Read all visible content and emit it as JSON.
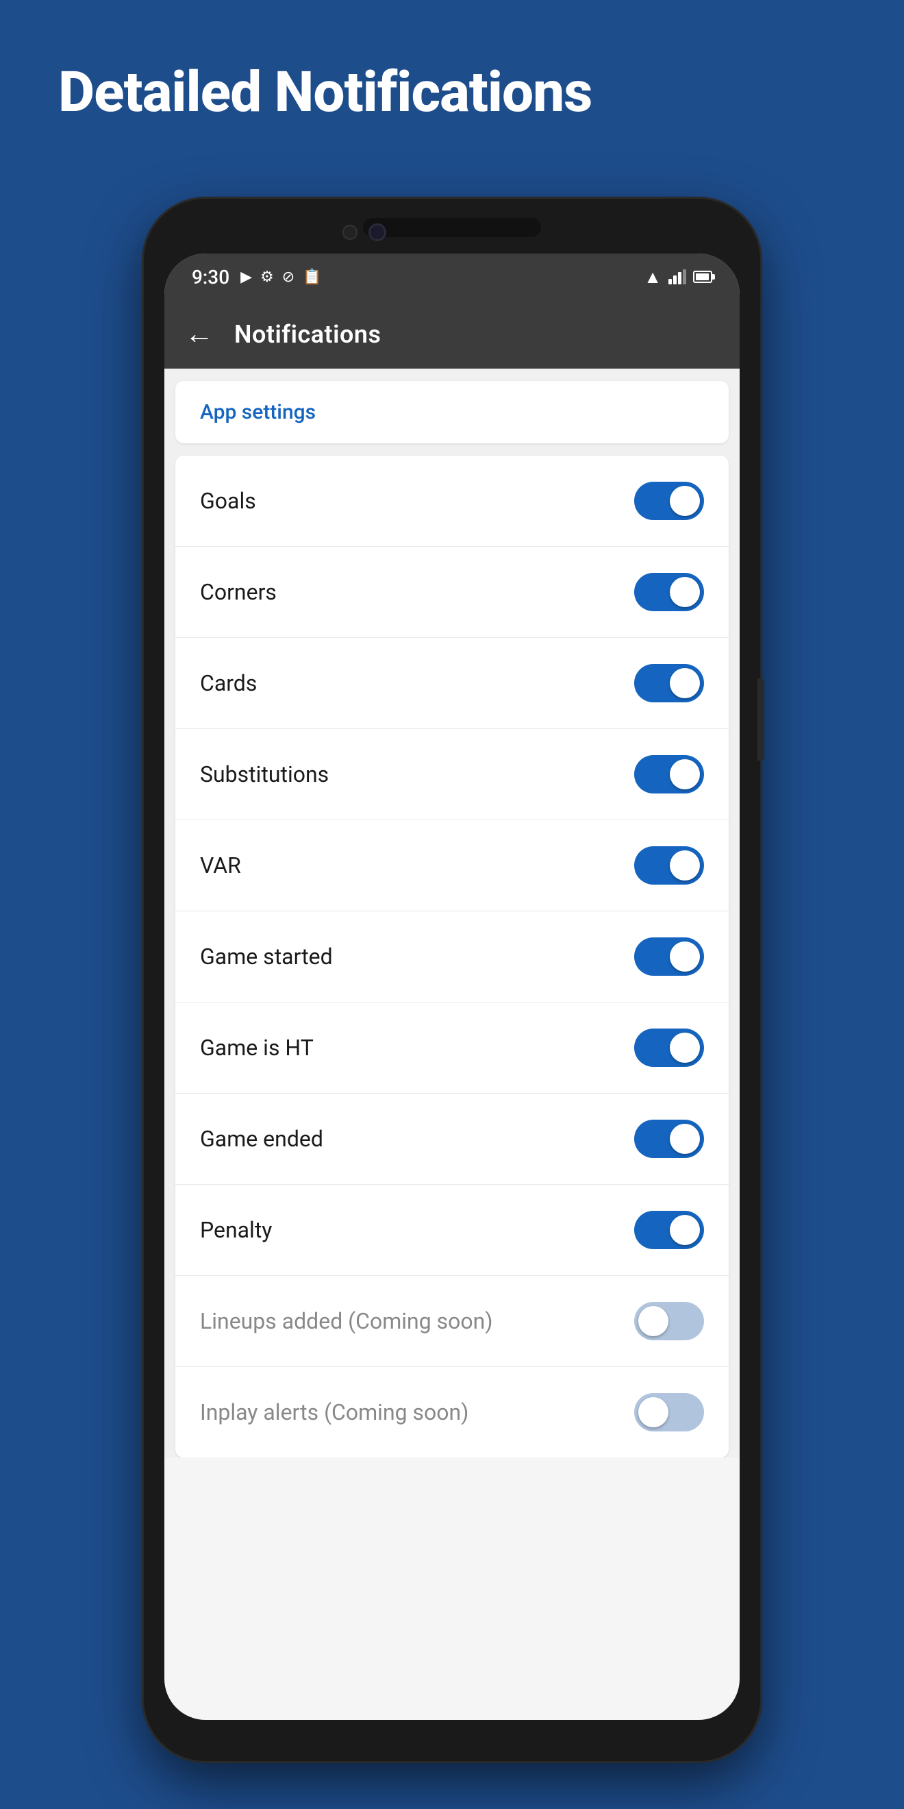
{
  "page": {
    "background_color": "#1e4d8c",
    "title": "Detailed Notifications"
  },
  "status_bar": {
    "time": "9:30",
    "icons_left": [
      "play-icon",
      "settings-icon",
      "blocked-icon",
      "clipboard-icon"
    ],
    "wifi": "wifi-icon",
    "signal": "signal-icon",
    "battery": "battery-icon"
  },
  "app_bar": {
    "back_button": "←",
    "title": "Notifications"
  },
  "app_settings": {
    "link_text": "App settings"
  },
  "settings": [
    {
      "label": "Goals",
      "toggle": "on",
      "disabled": false
    },
    {
      "label": "Corners",
      "toggle": "on",
      "disabled": false
    },
    {
      "label": "Cards",
      "toggle": "on",
      "disabled": false
    },
    {
      "label": "Substitutions",
      "toggle": "on",
      "disabled": false
    },
    {
      "label": "VAR",
      "toggle": "on",
      "disabled": false
    },
    {
      "label": "Game started",
      "toggle": "on",
      "disabled": false
    },
    {
      "label": "Game is HT",
      "toggle": "on",
      "disabled": false
    },
    {
      "label": "Game ended",
      "toggle": "on",
      "disabled": false
    },
    {
      "label": "Penalty",
      "toggle": "on",
      "disabled": false
    },
    {
      "label": "Lineups added (Coming soon)",
      "toggle": "off",
      "disabled": true
    },
    {
      "label": "Inplay alerts (Coming soon)",
      "toggle": "off",
      "disabled": true
    }
  ]
}
